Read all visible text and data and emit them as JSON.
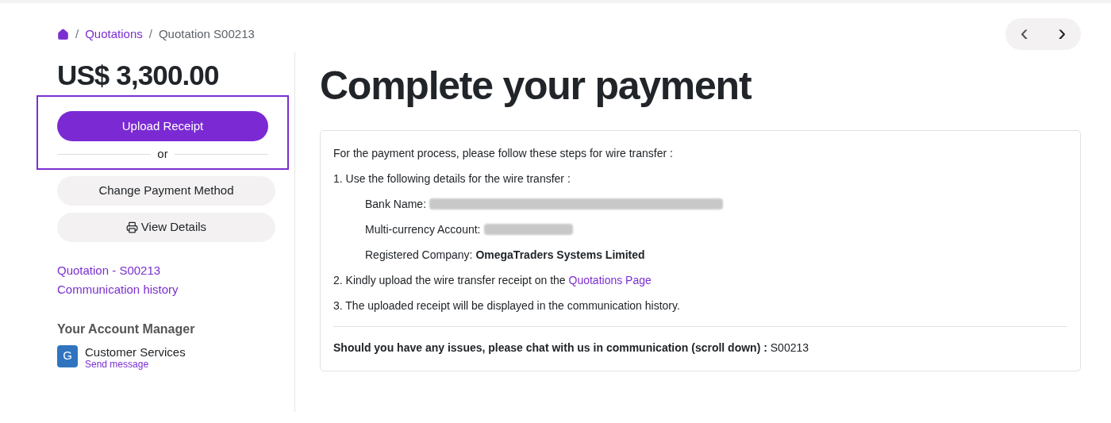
{
  "breadcrumb": {
    "items": [
      {
        "separator": "/",
        "label": "Quotations",
        "kind": "link"
      },
      {
        "separator": "/",
        "label": "Quotation S00213",
        "kind": "current"
      }
    ]
  },
  "pager": {
    "prev": "‹",
    "next": "›"
  },
  "sidebar": {
    "amount": "US$ 3,300.00",
    "upload": {
      "button": "Upload Receipt",
      "separator": "or",
      "highlighted": true
    },
    "buttons": [
      {
        "label": "Change Payment Method",
        "kind": "plain"
      },
      {
        "label": "View Details",
        "kind": "print"
      }
    ],
    "links": [
      "Quotation - S00213",
      "Communication history"
    ],
    "manager": {
      "heading": "Your Account Manager",
      "initial": "G",
      "name": "Customer Services",
      "action": "Send message"
    }
  },
  "main": {
    "title": "Complete your payment",
    "intro": "For the payment process, please follow these steps for wire transfer :",
    "step_1": "1. Use the following details for the wire transfer :",
    "details": [
      {
        "label": "Bank Name:",
        "redacted": true
      },
      {
        "label": "Multi-currency Account:",
        "redacted": true
      },
      {
        "label": "Registered Company:",
        "redacted": false,
        "value": "OmegaTraders Systems Limited"
      }
    ],
    "step_2": "2. Kindly upload the wire transfer receipt on the",
    "step_2_link": "Quotations Page",
    "step_3": "3. The uploaded receipt will be displayed in the communication history.",
    "footer": "Should you have any issues, please chat with us in communication (scroll down) :",
    "footer_ref": "S00213"
  }
}
